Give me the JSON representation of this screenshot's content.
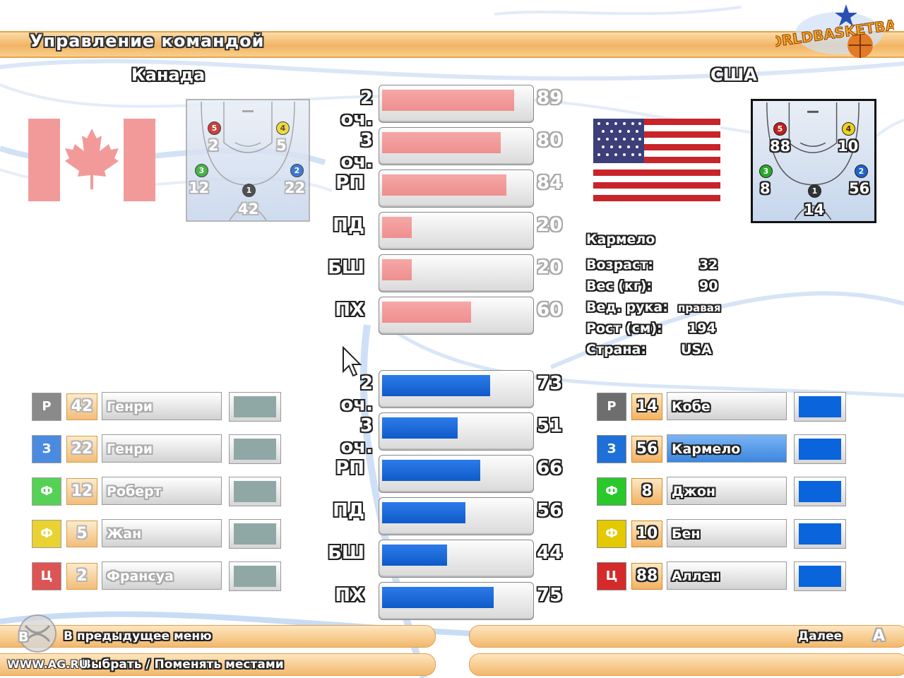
{
  "header": {
    "title": "Управление командой",
    "logo_text": "WORLDBASKETBALL"
  },
  "teams": {
    "left": {
      "name": "Канада",
      "flag": "canada-flag",
      "court_numbers": [
        "2",
        "5",
        "12",
        "22",
        "42"
      ]
    },
    "right": {
      "name": "США",
      "flag": "usa-flag",
      "court_numbers": [
        "88",
        "10",
        "8",
        "56",
        "14"
      ]
    }
  },
  "court_dots": [
    "5",
    "4",
    "3",
    "2",
    "1"
  ],
  "stat_labels": [
    "2 оч.",
    "3 оч.",
    "РП",
    "ПД",
    "БШ",
    "ПХ"
  ],
  "stats_left": [
    {
      "label": "2 оч.",
      "value": "89",
      "pct": 89
    },
    {
      "label": "3 оч.",
      "value": "80",
      "pct": 80
    },
    {
      "label": "РП",
      "value": "84",
      "pct": 84
    },
    {
      "label": "ПД",
      "value": "20",
      "pct": 20
    },
    {
      "label": "БШ",
      "value": "20",
      "pct": 20
    },
    {
      "label": "ПХ",
      "value": "60",
      "pct": 60
    }
  ],
  "stats_right": [
    {
      "label": "2 оч.",
      "value": "73",
      "pct": 73
    },
    {
      "label": "3 оч.",
      "value": "51",
      "pct": 51
    },
    {
      "label": "РП",
      "value": "66",
      "pct": 66
    },
    {
      "label": "ПД",
      "value": "56",
      "pct": 56
    },
    {
      "label": "БШ",
      "value": "44",
      "pct": 44
    },
    {
      "label": "ПХ",
      "value": "75",
      "pct": 75
    }
  ],
  "player_info": {
    "name": "Кармело",
    "age_label": "Возраст:",
    "age": "32",
    "weight_label": "Вес (кг):",
    "weight": "90",
    "hand_label": "Вед. рука:",
    "hand": "правая",
    "height_label": "Рост (см):",
    "height": "194",
    "country_label": "Страна:",
    "country": "USA"
  },
  "roster_left": [
    {
      "pos": "Р",
      "num": "42",
      "name": "Генри"
    },
    {
      "pos": "З",
      "num": "22",
      "name": "Генри"
    },
    {
      "pos": "Ф",
      "num": "12",
      "name": "Роберт"
    },
    {
      "pos": "Ф",
      "num": "5",
      "name": "Жан"
    },
    {
      "pos": "Ц",
      "num": "2",
      "name": "Франсуа"
    }
  ],
  "roster_right": [
    {
      "pos": "Р",
      "num": "14",
      "name": "Кобе"
    },
    {
      "pos": "З",
      "num": "56",
      "name": "Кармело"
    },
    {
      "pos": "Ф",
      "num": "8",
      "name": "Джон"
    },
    {
      "pos": "Ф",
      "num": "10",
      "name": "Бен"
    },
    {
      "pos": "Ц",
      "num": "88",
      "name": "Аллен"
    }
  ],
  "colors": {
    "pos_p": "#6e6e6e",
    "pos_z": "#1f6fd8",
    "pos_f1": "#2bc82b",
    "pos_f2": "#e4c800",
    "pos_c": "#d42a2a",
    "left_swatch": "#8fa8a6",
    "right_swatch": "#0a64dc",
    "bar_red": "#ee8f8f",
    "bar_blue": "#0f5ac9"
  },
  "footer": {
    "back_button_icon": "B",
    "back_label": "В предыдущее меню",
    "select_label": "Выбрать / Поменять местами",
    "next_label": "Далее",
    "next_button_icon": "A",
    "watermark": "WWW.AG.RU"
  }
}
